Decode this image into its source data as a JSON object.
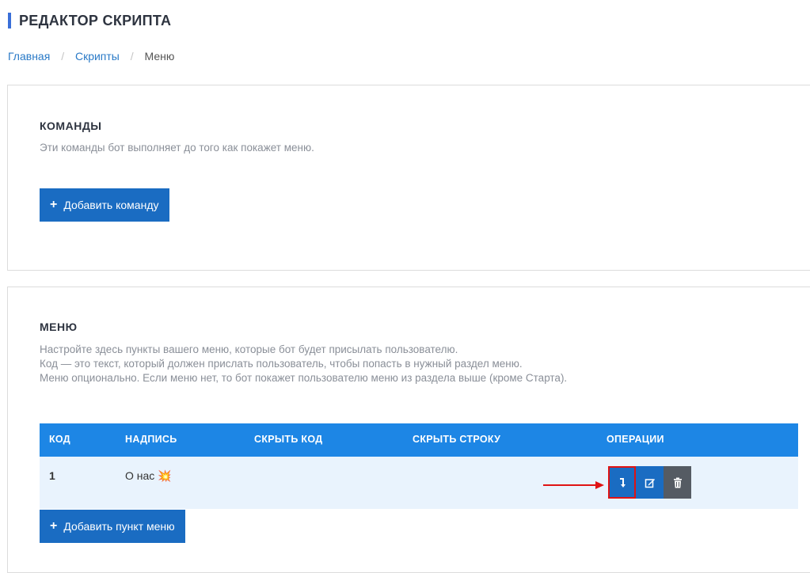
{
  "page": {
    "title": "РЕДАКТОР СКРИПТА",
    "breadcrumb": {
      "home": "Главная",
      "scripts": "Скрипты",
      "current": "Меню",
      "separator": "/"
    }
  },
  "commands": {
    "title": "КОМАНДЫ",
    "description": "Эти команды бот выполняет до того как покажет меню.",
    "add_button": "Добавить команду",
    "add_icon": "+"
  },
  "menu": {
    "title": "МЕНЮ",
    "description": [
      "Настройте здесь пункты вашего меню, которые бот будет присылать пользователю.",
      "Код — это текст, который должен прислать пользователь, чтобы попасть в нужный раздел меню.",
      "Меню опционально. Если меню нет, то бот покажет пользователю меню из раздела выше (кроме Старта)."
    ],
    "table": {
      "headers": {
        "code": "КОД",
        "label": "НАДПИСЬ",
        "hide_code": "СКРЫТЬ КОД",
        "hide_row": "СКРЫТЬ СТРОКУ",
        "operations": "ОПЕРАЦИИ"
      },
      "rows": [
        {
          "code": "1",
          "label": "О нас",
          "emoji": "💥",
          "hide_code": "",
          "hide_row": ""
        }
      ]
    },
    "add_button": "Добавить пункт меню",
    "add_icon": "+"
  },
  "icons": {
    "move": "move-down-icon",
    "edit": "edit-icon",
    "delete": "trash-icon"
  },
  "colors": {
    "accent": "#1a6cc2",
    "table_header": "#1d86e5",
    "row_bg": "#e9f3fd",
    "delete_button": "#555b63",
    "highlight": "#e01313"
  }
}
